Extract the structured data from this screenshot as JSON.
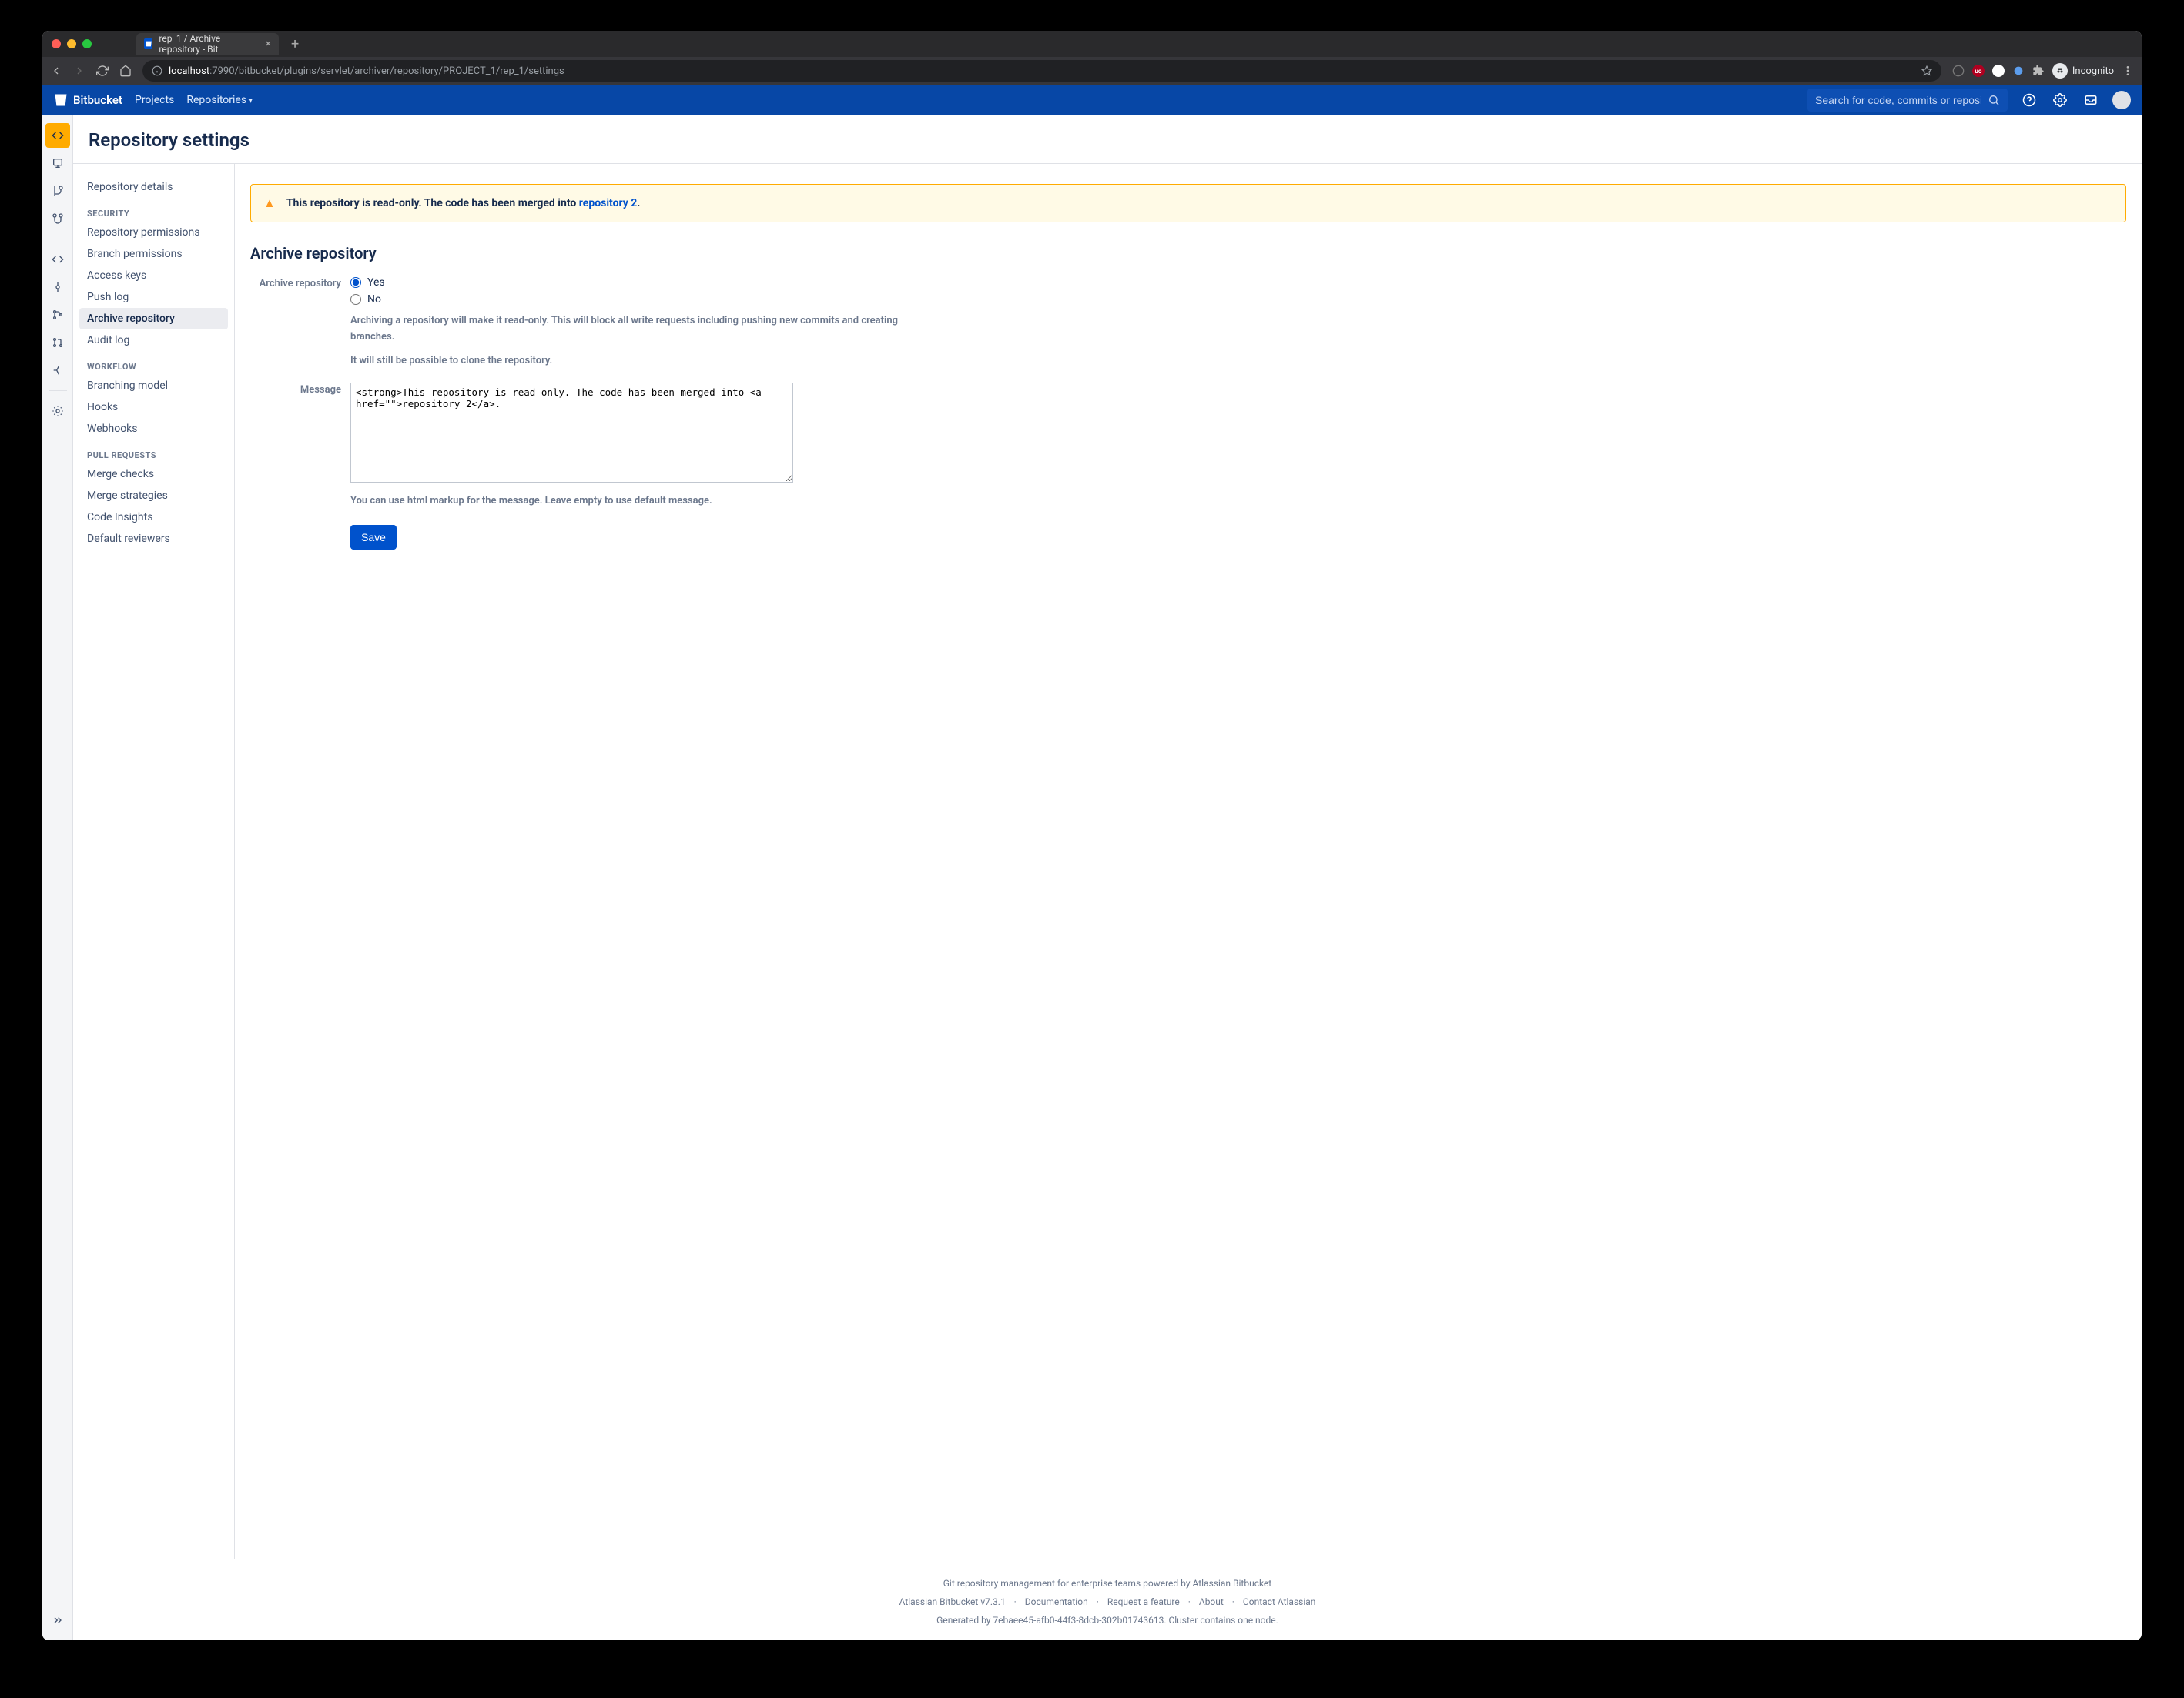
{
  "browser": {
    "tab_title": "rep_1 / Archive repository - Bit",
    "url_host": "localhost",
    "url_path": ":7990/bitbucket/plugins/servlet/archiver/repository/PROJECT_1/rep_1/settings",
    "incognito_label": "Incognito"
  },
  "header": {
    "brand": "Bitbucket",
    "nav": {
      "projects": "Projects",
      "repositories": "Repositories"
    },
    "search_placeholder": "Search for code, commits or repositories..."
  },
  "page": {
    "title": "Repository settings"
  },
  "sidebar": {
    "details": "Repository details",
    "groups": [
      {
        "heading": "SECURITY",
        "items": [
          "Repository permissions",
          "Branch permissions",
          "Access keys",
          "Push log",
          "Archive repository",
          "Audit log"
        ]
      },
      {
        "heading": "WORKFLOW",
        "items": [
          "Branching model",
          "Hooks",
          "Webhooks"
        ]
      },
      {
        "heading": "PULL REQUESTS",
        "items": [
          "Merge checks",
          "Merge strategies",
          "Code Insights",
          "Default reviewers"
        ]
      }
    ],
    "active": "Archive repository"
  },
  "banner": {
    "prefix": "This repository is read-only. The code has been merged into ",
    "link_text": "repository 2",
    "suffix": "."
  },
  "section": {
    "title": "Archive repository",
    "field_label": "Archive repository",
    "option_yes": "Yes",
    "option_no": "No",
    "help1": "Archiving a repository will make it read-only. This will block all write requests including pushing new commits and creating branches.",
    "help2": "It will still be possible to clone the repository.",
    "message_label": "Message",
    "message_value": "<strong>This repository is read-only. The code has been merged into <a href=\"\">repository 2</a>.",
    "message_help": "You can use html markup for the message. Leave empty to use default message.",
    "save_label": "Save"
  },
  "footer": {
    "tagline": "Git repository management for enterprise teams powered by Atlassian Bitbucket",
    "version": "Atlassian Bitbucket v7.3.1",
    "links": [
      "Documentation",
      "Request a feature",
      "About",
      "Contact Atlassian"
    ],
    "generated": "Generated by 7ebaee45-afb0-44f3-8dcb-302b01743613. Cluster contains one node."
  }
}
